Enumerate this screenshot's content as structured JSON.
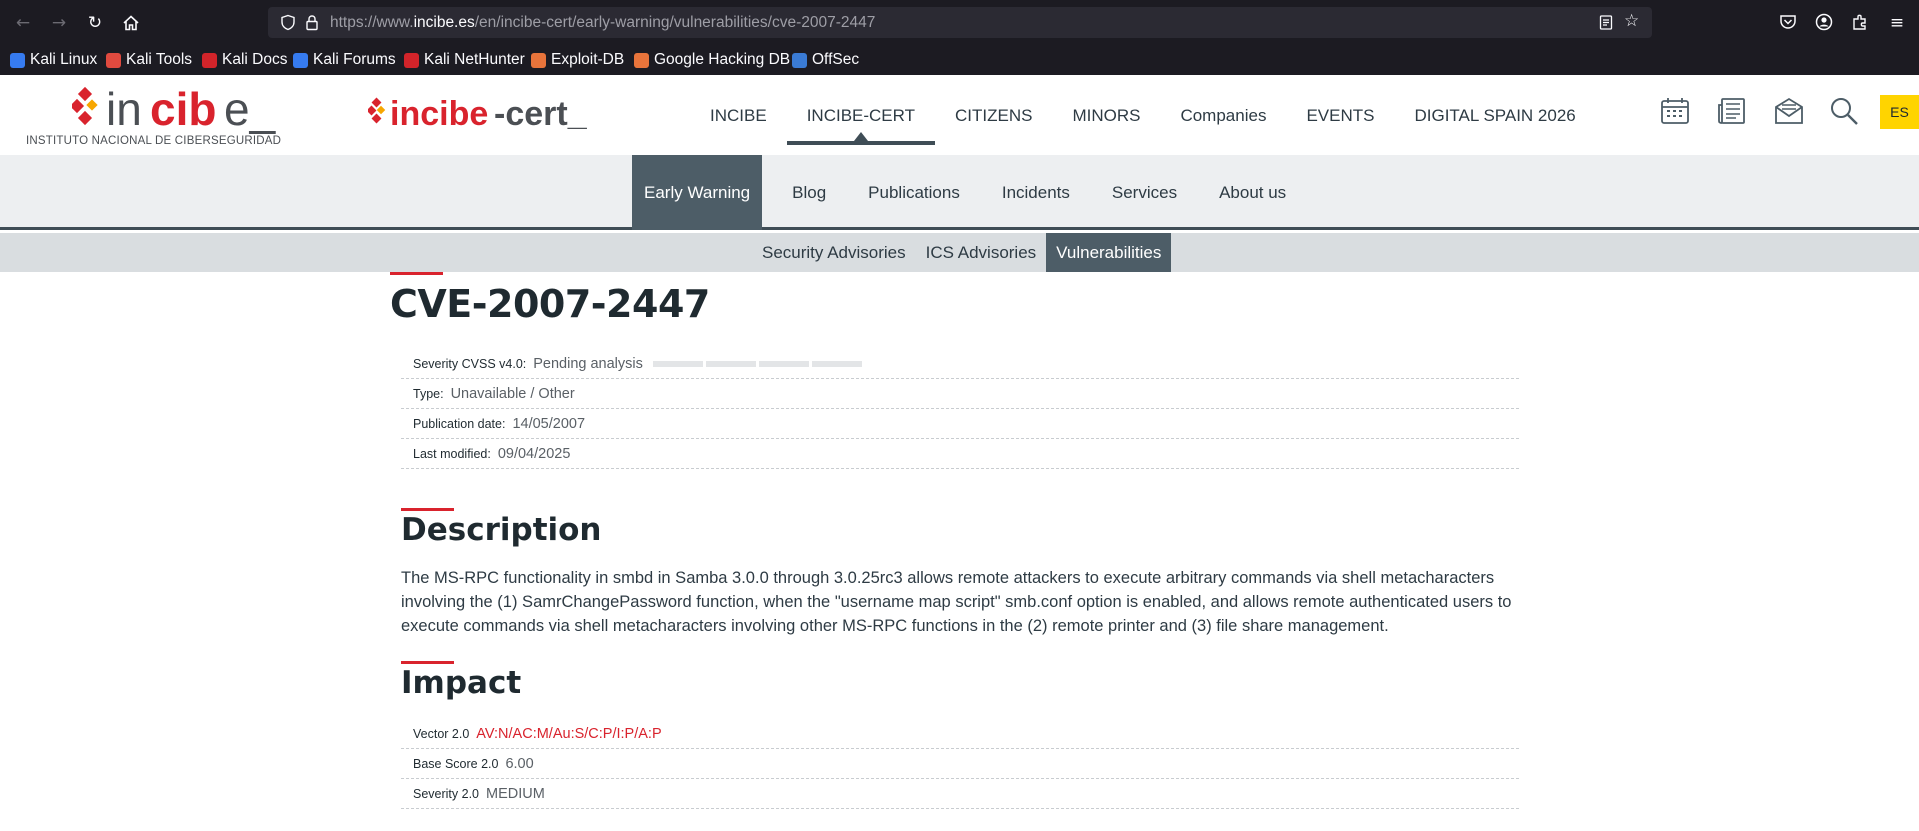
{
  "browser": {
    "url_prefix": "https://www.",
    "url_domain": "incibe.es",
    "url_path": "/en/incibe-cert/early-warning/vulnerabilities/cve-2007-2447",
    "bookmarks": [
      {
        "label": "Kali Linux",
        "icon": "kali-dragon-icon",
        "color": "#367bf0"
      },
      {
        "label": "Kali Tools",
        "icon": "kali-tools-icon",
        "color": "#e04a3f"
      },
      {
        "label": "Kali Docs",
        "icon": "kali-docs-icon",
        "color": "#d2242a"
      },
      {
        "label": "Kali Forums",
        "icon": "kali-forums-icon",
        "color": "#367bf0"
      },
      {
        "label": "Kali NetHunter",
        "icon": "nethunter-icon",
        "color": "#d2242a"
      },
      {
        "label": "Exploit-DB",
        "icon": "exploit-db-icon",
        "color": "#e8743b"
      },
      {
        "label": "Google Hacking DB",
        "icon": "ghdb-icon",
        "color": "#e8743b"
      },
      {
        "label": "OffSec",
        "icon": "offsec-icon",
        "color": "#3a7bd5"
      }
    ]
  },
  "header": {
    "logo_incibe_sub": "INSTITUTO NACIONAL DE CIBERSEGURIDAD",
    "main_nav": [
      "INCIBE",
      "INCIBE-CERT",
      "CITIZENS",
      "MINORS",
      "Companies",
      "EVENTS",
      "DIGITAL SPAIN 2026"
    ],
    "main_nav_active": "INCIBE-CERT",
    "lang": "ES"
  },
  "subnav": {
    "items": [
      "Early Warning",
      "Blog",
      "Publications",
      "Incidents",
      "Services",
      "About us"
    ],
    "active": "Early Warning"
  },
  "thirdnav": {
    "items": [
      "Security Advisories",
      "ICS Advisories",
      "Vulnerabilities"
    ],
    "active": "Vulnerabilities"
  },
  "vuln": {
    "title": "CVE-2007-2447",
    "meta": [
      {
        "key": "Severity CVSS v4.0:",
        "value": "Pending analysis"
      },
      {
        "key": "Type:",
        "value": "Unavailable / Other"
      },
      {
        "key": "Publication date:",
        "value": "14/05/2007"
      },
      {
        "key": "Last modified:",
        "value": "09/04/2025"
      }
    ],
    "description_title": "Description",
    "description": "The MS-RPC functionality in smbd in Samba 3.0.0 through 3.0.25rc3 allows remote attackers to execute arbitrary commands via shell metacharacters involving the (1) SamrChangePassword function, when the \"username map script\" smb.conf option is enabled, and allows remote authenticated users to execute commands via shell metacharacters involving other MS-RPC functions in the (2) remote printer and (3) file share management.",
    "impact_title": "Impact",
    "impact": [
      {
        "key": "Vector 2.0",
        "value": "AV:N/AC:M/Au:S/C:P/I:P/A:P"
      },
      {
        "key": "Base Score 2.0",
        "value": "6.00"
      },
      {
        "key": "Severity 2.0",
        "value": "MEDIUM"
      }
    ]
  },
  "colors": {
    "brand_red": "#d9232d",
    "nav_active": "#4d5d67",
    "lang_yellow": "#ffd400"
  }
}
